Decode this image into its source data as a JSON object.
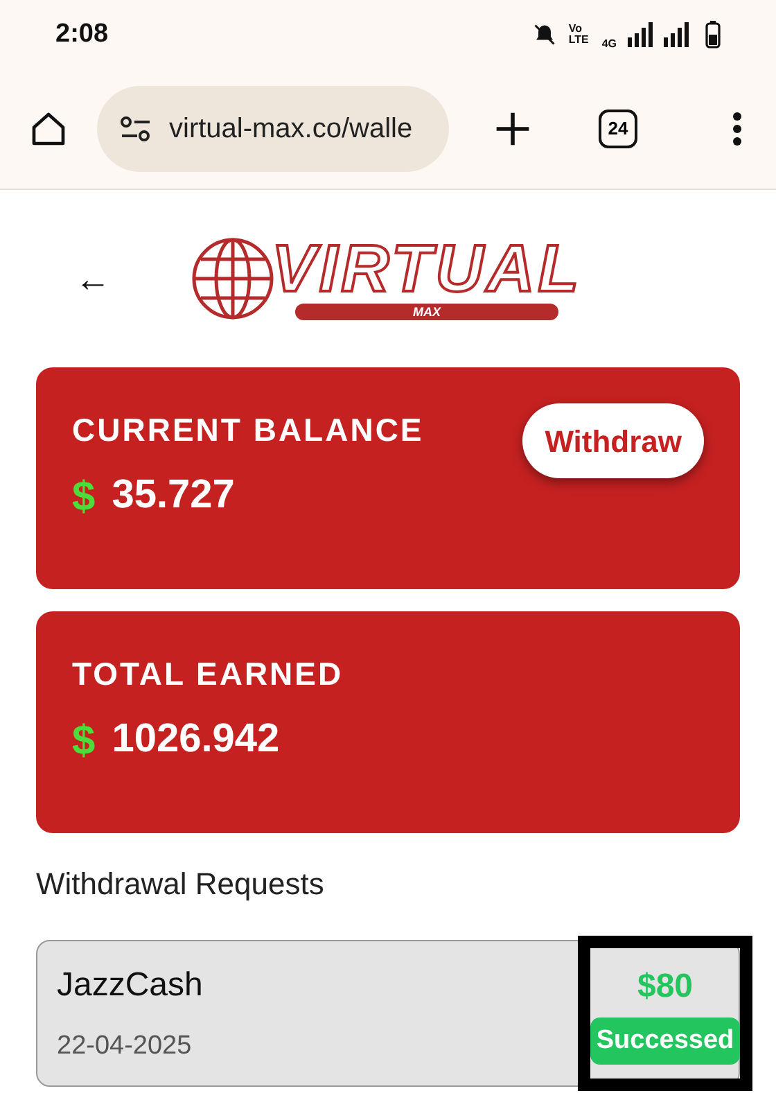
{
  "status_bar": {
    "time": "2:08",
    "volte": "Vo LTE",
    "network": "4G"
  },
  "browser": {
    "url": "virtual-max.co/walle",
    "tab_count": "24"
  },
  "header": {
    "back": "←",
    "logo_title": "VIRTUAL",
    "logo_sub": "MAX"
  },
  "cards": [
    {
      "label": "CURRENT BALANCE",
      "currency": "$",
      "amount": "35.727",
      "action": "Withdraw"
    },
    {
      "label": "TOTAL EARNED",
      "currency": "$",
      "amount": "1026.942"
    }
  ],
  "requests_title": "Withdrawal Requests",
  "requests": [
    {
      "method": "JazzCash",
      "date": "22-04-2025",
      "amount": "$80",
      "status": "Successed",
      "kind": "success",
      "highlighted": true
    }
  ]
}
